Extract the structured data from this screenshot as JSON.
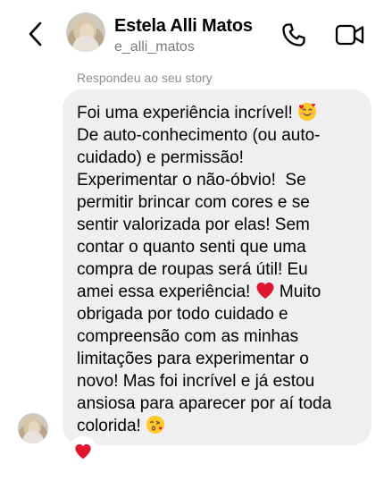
{
  "header": {
    "name": "Estela Alli Matos",
    "username": "e_alli_matos",
    "back_icon": "chevron-left-icon",
    "call_icon": "phone-icon",
    "video_icon": "video-camera-icon"
  },
  "message": {
    "replied_label": "Respondeu ao seu story",
    "lines": [
      "Foi uma experiência incrível! ",
      "De auto-conhecimento (ou auto-",
      "cuidado) e permissão!",
      "Experimentar o não-óbvio!  Se",
      "permitir brincar com cores e se",
      "sentir valorizada por elas! Sem",
      "contar o quanto senti que uma",
      "compra de roupas será útil! Eu",
      "amei essa experiência! ",
      " Muito",
      "obrigada por todo cuidado e",
      "compreensão com as minhas",
      "limitações para experimentar o",
      "novo! Mas foi incrível e já estou",
      "ansiosa para aparecer por aí toda",
      "colorida! "
    ],
    "emojis": {
      "line1": "smiling-face-with-hearts-icon",
      "line9": "red-heart-icon",
      "line16": "face-blowing-kiss-icon"
    },
    "reaction_icon": "red-heart-icon"
  },
  "colors": {
    "bubble": "#efeff2",
    "secondary_text": "#7a7a7a",
    "heart": "#e0152e"
  }
}
